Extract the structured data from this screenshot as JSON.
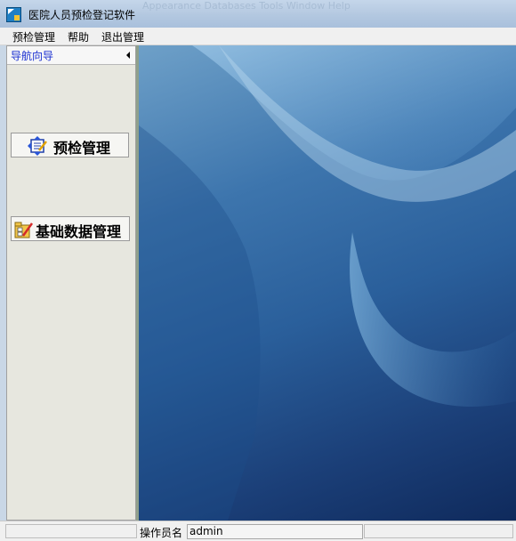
{
  "window": {
    "title": "医院人员预检登记软件",
    "ghost_menu": "Appearance    Databases    Tools    Window    Help"
  },
  "menu": {
    "items": [
      "预检管理",
      "帮助",
      "退出管理"
    ]
  },
  "nav": {
    "header": "导航向导",
    "buttons": [
      {
        "label": "预检管理",
        "icon": "checklist-icon"
      },
      {
        "label": "基础数据管理",
        "icon": "folder-edit-icon"
      }
    ]
  },
  "status": {
    "operator_label": "操作员名",
    "operator_value": "admin"
  },
  "colors": {
    "nav_header_text": "#1a2fd1",
    "desktop_blue": "#2a5f9b"
  }
}
